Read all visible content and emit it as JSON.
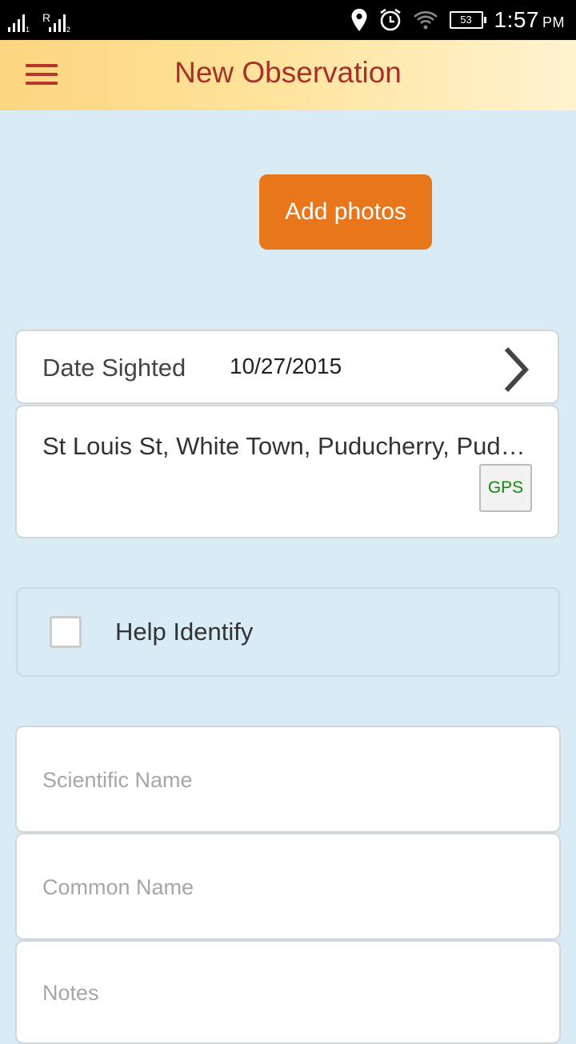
{
  "status_bar": {
    "sim1_index": "1",
    "sim2_roaming": "R",
    "sim2_index": "2",
    "battery_level": "53",
    "time": "1:57",
    "ampm": "PM",
    "icons": [
      "signal-icon",
      "signal-roaming-icon",
      "location-icon",
      "alarm-icon",
      "wifi-icon",
      "battery-icon"
    ]
  },
  "appbar": {
    "title": "New Observation",
    "menu_icon": "hamburger-menu-icon",
    "title_color": "#a8302a"
  },
  "actions": {
    "add_photos_label": "Add photos",
    "accent_color": "#e8771c"
  },
  "date": {
    "label": "Date Sighted",
    "value": "10/27/2015"
  },
  "location": {
    "text": "St Louis St, White Town, Puducherry, Puducherry",
    "gps_label": "GPS"
  },
  "help": {
    "label": "Help Identify",
    "checked": false
  },
  "fields": {
    "scientific_name_placeholder": "Scientific Name",
    "common_name_placeholder": "Common Name",
    "notes_placeholder": "Notes"
  }
}
